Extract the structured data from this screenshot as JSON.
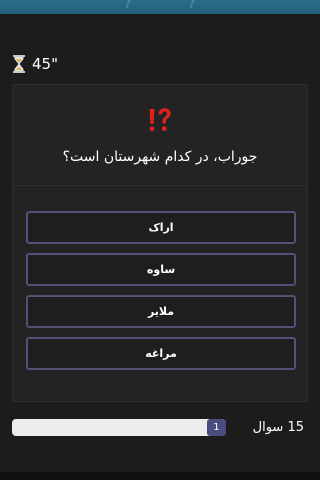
{
  "timer": {
    "seconds_label": "45\"",
    "icon": "hourglass-icon"
  },
  "question": {
    "icon": "exclamation-question-icon",
    "text": "جوراب، در کدام شهرستان است؟"
  },
  "options": [
    {
      "label": "اراک"
    },
    {
      "label": "ساوه"
    },
    {
      "label": "ملایر"
    },
    {
      "label": "مراغه"
    }
  ],
  "progress": {
    "current_label": "1",
    "fraction": 0.09
  },
  "question_count_label": "15 سوال",
  "colors": {
    "background": "#1c1c1c",
    "card": "#232323",
    "option_border": "#55507a",
    "progress_fill": "#4a4b7e",
    "banner": "#2b6e8c"
  }
}
